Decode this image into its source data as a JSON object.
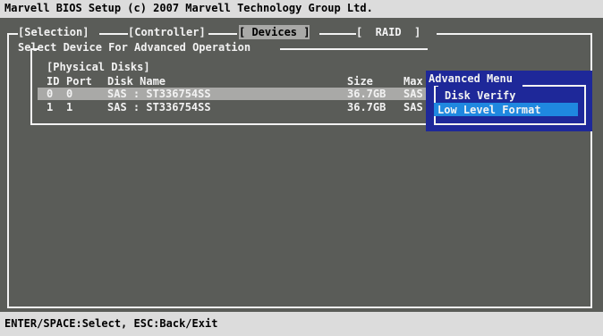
{
  "title": "Marvell BIOS Setup (c) 2007 Marvell Technology Group Ltd.",
  "tabs": [
    {
      "label": "[Selection]"
    },
    {
      "label": "[Controller]"
    },
    {
      "label": "[ Devices ]"
    },
    {
      "label": "[  RAID  ]"
    }
  ],
  "active_tab": "Devices",
  "panel_heading": "Select Device For Advanced Operation",
  "disks": {
    "heading": "[Physical Disks]",
    "columns": [
      "ID",
      "Port",
      "Disk Name",
      "Size",
      "Max"
    ],
    "rows": [
      {
        "id": "0",
        "port": "0",
        "name": "SAS : ST336754SS",
        "size": "36.7GB",
        "max": "SAS"
      },
      {
        "id": "1",
        "port": "1",
        "name": "SAS : ST336754SS",
        "size": "36.7GB",
        "max": "SAS"
      }
    ]
  },
  "advanced_menu": {
    "title": "Advanced Menu",
    "items": [
      "Disk Verify",
      "Low Level Format"
    ],
    "selected": "Low Level Format"
  },
  "status": "ENTER/SPACE:Select, ESC:Back/Exit",
  "colors": {
    "background": "#5a5c58",
    "bar": "#dcdcdc",
    "highlight_gray": "#a9a9a7",
    "menu_blue": "#1e2899",
    "menu_highlight": "#1f88e0",
    "text": "#f2f2f2"
  }
}
